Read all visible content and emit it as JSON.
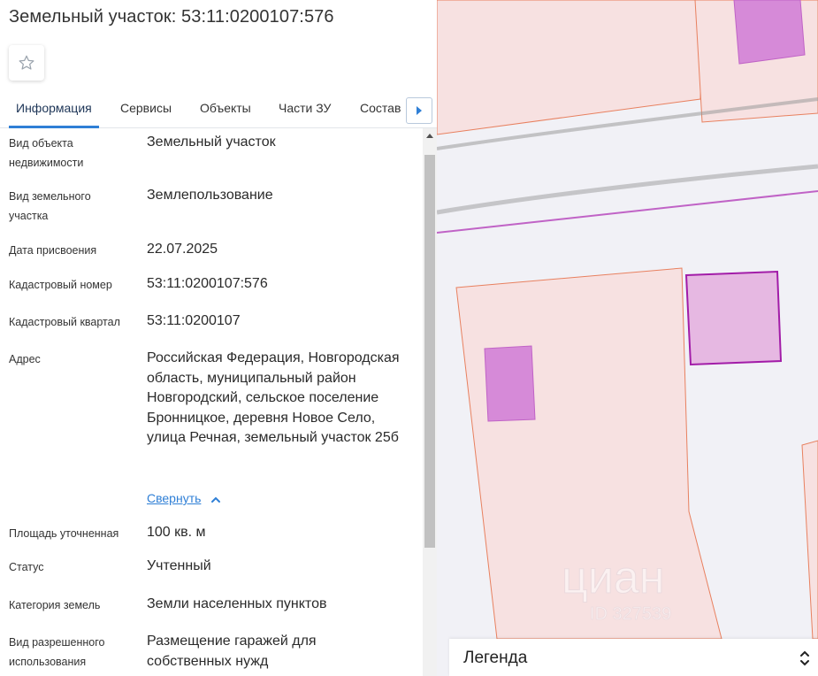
{
  "title": "Земельный участок: 53:11:0200107:576",
  "tabs": [
    {
      "label": "Информация",
      "active": true
    },
    {
      "label": "Сервисы"
    },
    {
      "label": "Объекты"
    },
    {
      "label": "Части ЗУ"
    },
    {
      "label": "Состав"
    }
  ],
  "rows": [
    {
      "label": "Вид объекта недвижимости",
      "value": "Земельный участок"
    },
    {
      "label": "Вид земельного участка",
      "value": "Землепользование"
    },
    {
      "label": "Дата присвоения",
      "value": "22.07.2025"
    },
    {
      "label": "Кадастровый номер",
      "value": "53:11:0200107:576"
    },
    {
      "label": "Кадастровый квартал",
      "value": "53:11:0200107"
    },
    {
      "label": "Адрес",
      "value": "Российская Федерация, Новгородская область, муниципальный район Новгородский, сельское поселение Бронницкое, деревня Новое Село, улица Речная, земельный участок 25б"
    },
    {
      "label": "Площадь уточненная",
      "value": "100 кв. м"
    },
    {
      "label": "Статус",
      "value": "Учтенный"
    },
    {
      "label": "Категория земель",
      "value": "Земли населенных пунктов"
    },
    {
      "label": "Вид разрешенного использования",
      "value": "Размещение гаражей для собственных нужд"
    }
  ],
  "collapse_label": "Свернуть",
  "legend": {
    "title": "Легенда"
  },
  "watermark": {
    "brand": "циан",
    "id_text": "ID 327539"
  },
  "icons": {
    "favorite": "star-outline-icon",
    "tabs_next": "caret-right-icon",
    "collapse": "chevron-up-icon",
    "legend_toggle": "chevron-up-down-icon"
  },
  "colors": {
    "accent": "#2f7fd6",
    "parcel_fill": "#f7e1e1",
    "parcel_stroke": "#e8805f",
    "building_fill": "#d68ad8",
    "selected_stroke": "#a21ca8"
  }
}
